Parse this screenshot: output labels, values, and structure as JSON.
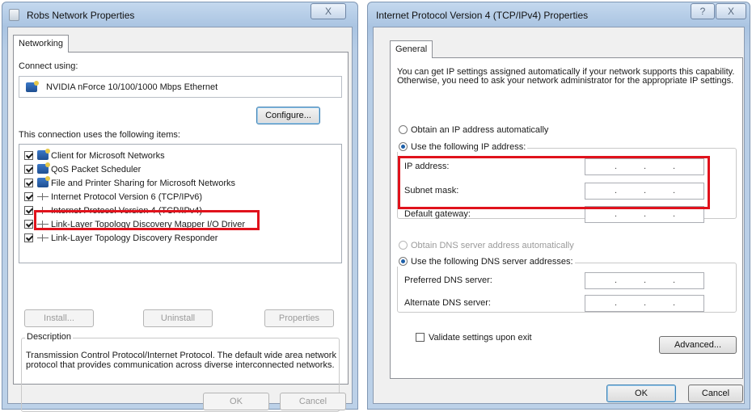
{
  "window1": {
    "title": "Robs Network Properties",
    "close_glyph": "X",
    "tab_label": "Networking",
    "connect_using_label": "Connect using:",
    "adapter_name": "NVIDIA nForce 10/100/1000 Mbps Ethernet",
    "configure_label": "Configure...",
    "items_label": "This connection uses the following items:",
    "items": [
      {
        "label": "Client for Microsoft Networks",
        "checked": true,
        "icon": "network-client-icon"
      },
      {
        "label": "QoS Packet Scheduler",
        "checked": true,
        "icon": "qos-icon"
      },
      {
        "label": "File and Printer Sharing for Microsoft Networks",
        "checked": true,
        "icon": "file-printer-sharing-icon"
      },
      {
        "label": "Internet Protocol Version 6 (TCP/IPv6)",
        "checked": true,
        "icon": "protocol-icon"
      },
      {
        "label": "Internet Protocol Version 4 (TCP/IPv4)",
        "checked": true,
        "icon": "protocol-icon"
      },
      {
        "label": "Link-Layer Topology Discovery Mapper I/O Driver",
        "checked": true,
        "icon": "protocol-icon"
      },
      {
        "label": "Link-Layer Topology Discovery Responder",
        "checked": true,
        "icon": "protocol-icon"
      }
    ],
    "install_label": "Install...",
    "uninstall_label": "Uninstall",
    "properties_label": "Properties",
    "description_label": "Description",
    "description_text": "Transmission Control Protocol/Internet Protocol. The default wide area network protocol that provides communication across diverse interconnected networks.",
    "ok_label": "OK",
    "cancel_label": "Cancel"
  },
  "window2": {
    "title": "Internet Protocol Version 4 (TCP/IPv4) Properties",
    "help_glyph": "?",
    "close_glyph": "X",
    "tab_label": "General",
    "intro_text": "You can get IP settings assigned automatically if your network supports this capability. Otherwise, you need to ask your network administrator for the appropriate IP settings.",
    "obtain_ip_auto_label": "Obtain an IP address automatically",
    "use_following_ip_label": "Use the following IP address:",
    "ip_address_label": "IP address:",
    "subnet_mask_label": "Subnet mask:",
    "default_gateway_label": "Default gateway:",
    "obtain_dns_auto_label": "Obtain DNS server address automatically",
    "use_following_dns_label": "Use the following DNS server addresses:",
    "preferred_dns_label": "Preferred DNS server:",
    "alternate_dns_label": "Alternate DNS server:",
    "validate_label": "Validate settings upon exit",
    "advanced_label": "Advanced...",
    "ok_label": "OK",
    "cancel_label": "Cancel",
    "ip_value": ".       .       .",
    "selected_ip_mode": "manual",
    "selected_dns_mode": "manual",
    "validate_checked": false
  },
  "highlight_color": "#e0121c"
}
